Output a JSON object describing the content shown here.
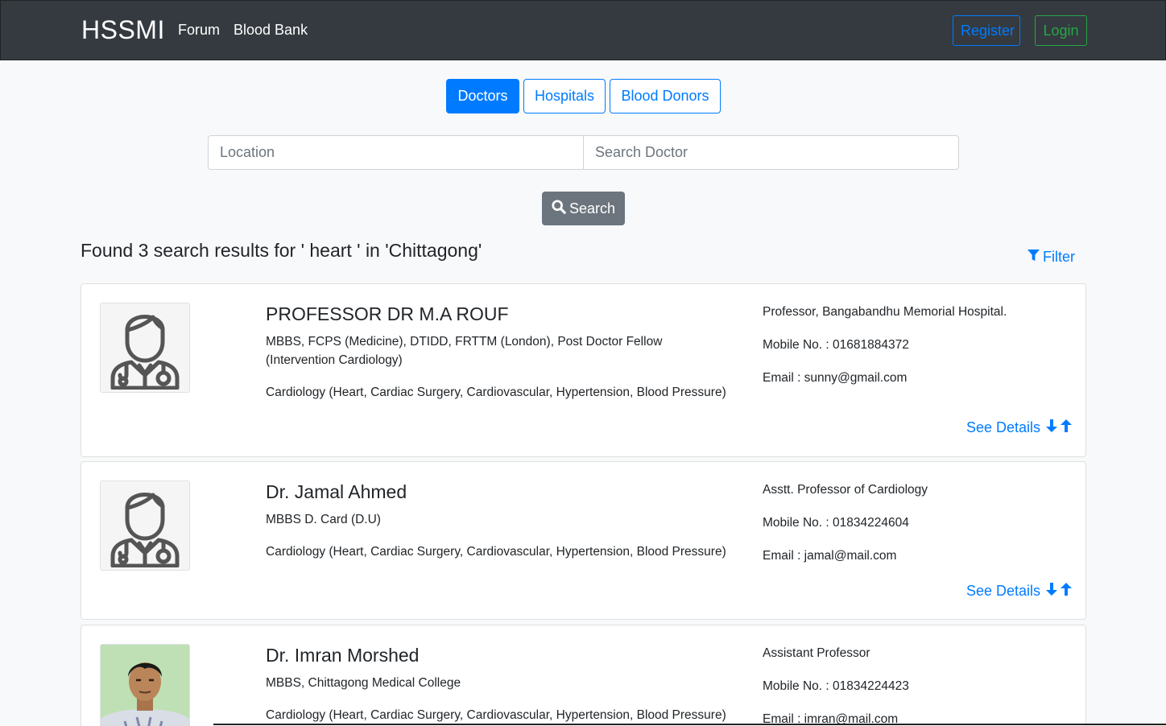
{
  "navbar": {
    "brand": "HSSMI",
    "links": [
      "Forum",
      "Blood Bank"
    ],
    "register_label": "Register",
    "login_label": "Login"
  },
  "tabs": [
    {
      "label": "Doctors",
      "active": true
    },
    {
      "label": "Hospitals",
      "active": false
    },
    {
      "label": "Blood Donors",
      "active": false
    }
  ],
  "search": {
    "location_placeholder": "Location",
    "doctor_placeholder": "Search Doctor",
    "button_label": "Search"
  },
  "results": {
    "title": "Found 3 search results for ' heart ' in 'Chittagong'",
    "filter_label": "Filter",
    "see_details_label": "See Details"
  },
  "doctors": [
    {
      "name": "PROFESSOR DR M.A ROUF",
      "qualification": "MBBS, FCPS (Medicine), DTIDD, FRTTM (London), Post Doctor Fellow (Intervention Cardiology)",
      "specialty": "Cardiology (Heart, Cardiac Surgery, Cardiovascular, Hypertension, Blood Pressure)",
      "designation": "Professor, Bangabandhu Memorial Hospital.",
      "mobile": "Mobile No. : 01681884372",
      "email": "Email : sunny@gmail.com",
      "avatar": "doctor-placeholder-icon"
    },
    {
      "name": "Dr. Jamal Ahmed",
      "qualification": "MBBS D. Card (D.U)",
      "specialty": "Cardiology (Heart, Cardiac Surgery, Cardiovascular, Hypertension, Blood Pressure)",
      "designation": "Asstt. Professor of Cardiology",
      "mobile": "Mobile No. : 01834224604",
      "email": "Email : jamal@mail.com",
      "avatar": "doctor-placeholder-icon"
    },
    {
      "name": "Dr. Imran Morshed",
      "qualification": "MBBS, Chittagong Medical College",
      "specialty": "Cardiology (Heart, Cardiac Surgery, Cardiovascular, Hypertension, Blood Pressure)",
      "designation": "Assistant Professor",
      "mobile": "Mobile No. : 01834224423",
      "email": "Email : imran@mail.com",
      "avatar": "photo"
    }
  ],
  "colors": {
    "navbar_bg": "#343a40",
    "primary": "#007bff",
    "success": "#28a745",
    "secondary": "#6c757d"
  }
}
